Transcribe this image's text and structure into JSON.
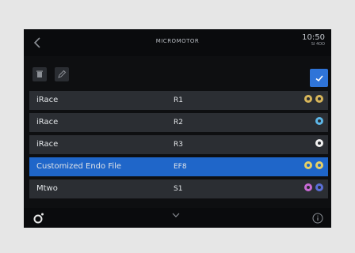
{
  "header": {
    "back_icon": "chevron-left-icon",
    "title": "MICROMOTOR",
    "time": "10:50",
    "date": "SI 4OO"
  },
  "toolbar": {
    "trash_icon": "trash-icon",
    "edit_icon": "pencil-icon",
    "confirm_icon": "check-icon",
    "accent": "#2f74d8"
  },
  "rows": [
    {
      "name": "iRace",
      "code": "R1",
      "dots": [
        "#d8b65a",
        "#d8b65a"
      ],
      "selected": false
    },
    {
      "name": "iRace",
      "code": "R2",
      "dots": [
        "#5db7e8"
      ],
      "selected": false
    },
    {
      "name": "iRace",
      "code": "R3",
      "dots": [
        "#f2f2f2"
      ],
      "selected": false
    },
    {
      "name": "Customized Endo File",
      "code": "EF8",
      "dots": [
        "#e6d066",
        "#e6d066"
      ],
      "selected": true
    },
    {
      "name": "Mtwo",
      "code": "S1",
      "dots": [
        "#c86ad6",
        "#5a6fd6"
      ],
      "selected": false
    }
  ],
  "footer": {
    "motor_icon": "motor-settings-icon",
    "info_icon": "info-icon",
    "scroll_icon": "chevron-down-icon"
  },
  "colors": {
    "selected_row": "#1f66c9",
    "row_bg": "#2b2e33",
    "screen_bg": "#0e0f11"
  }
}
